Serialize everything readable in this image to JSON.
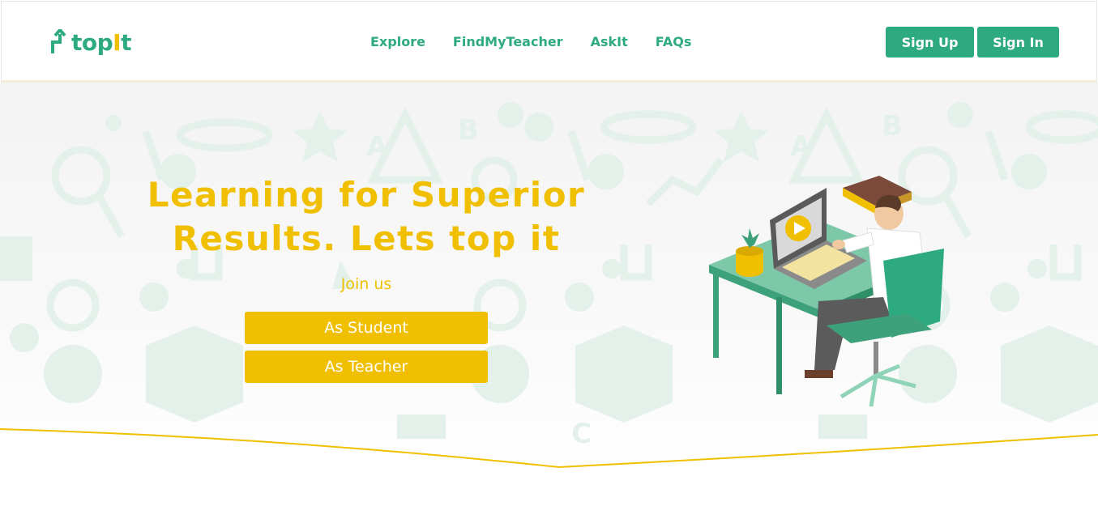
{
  "brand": {
    "name_start": "top",
    "name_highlight": "I",
    "name_end": "t"
  },
  "nav": {
    "items": [
      "Explore",
      "FindMyTeacher",
      "AskIt",
      "FAQs"
    ]
  },
  "auth": {
    "signup_label": "Sign Up",
    "signin_label": "Sign In"
  },
  "hero": {
    "headline_line1": "Learning for Superior",
    "headline_line2": "Results. Lets top it",
    "join_label": "Join us",
    "student_button": "As Student",
    "teacher_button": "As Teacher"
  },
  "colors": {
    "brand_green": "#2eaa80",
    "accent_yellow": "#f0bf00",
    "pattern_mint": "#e3f1ea"
  },
  "icons": [
    "logo-arrow-icon",
    "education-pattern-icons",
    "desk-learner-illustration"
  ]
}
